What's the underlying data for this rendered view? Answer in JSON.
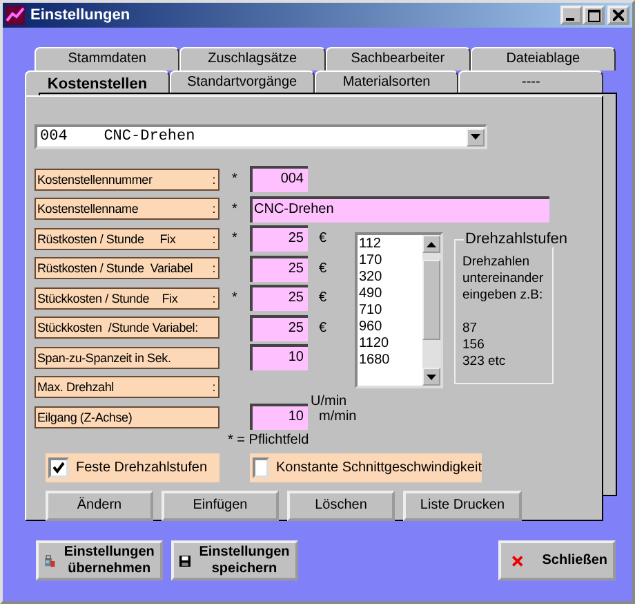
{
  "window": {
    "title": "Einstellungen"
  },
  "tab_rows": [
    {
      "tabs": [
        {
          "label": "Stammdaten",
          "selected": false
        },
        {
          "label": "Zuschlagsätze",
          "selected": false
        },
        {
          "label": "Sachbearbeiter",
          "selected": false
        },
        {
          "label": "Dateiablage",
          "selected": false
        }
      ]
    },
    {
      "tabs": [
        {
          "label": "Kostenstellen",
          "selected": true
        },
        {
          "label": "Standartvorgänge",
          "selected": false
        },
        {
          "label": "Materialsorten",
          "selected": false
        },
        {
          "label": "----",
          "selected": false
        }
      ]
    }
  ],
  "combo": {
    "value": "004    CNC-Drehen"
  },
  "fields": [
    {
      "label": "Kostenstellennummer",
      "colon": ":",
      "required": true,
      "kind": "short",
      "value": "004"
    },
    {
      "label": "Kostenstellenname",
      "colon": ":",
      "required": true,
      "kind": "wide",
      "value": "CNC-Drehen"
    },
    {
      "label": "Rüstkosten / Stunde     Fix",
      "colon": ":",
      "required": true,
      "kind": "short",
      "value": "25",
      "unit": "€"
    },
    {
      "label": "Rüstkosten / Stunde  Variabel",
      "colon": ":",
      "required": false,
      "kind": "short",
      "value": "25",
      "unit": "€"
    },
    {
      "label": "Stückkosten / Stunde    Fix",
      "colon": ":",
      "required": true,
      "kind": "short",
      "value": "25",
      "unit": "€"
    },
    {
      "label": "Stückkosten  /Stunde Variabel:",
      "required": false,
      "kind": "short",
      "value": "25",
      "unit": "€"
    },
    {
      "label": "Span-zu-Spanzeit in Sek.",
      "required": false,
      "kind": "short",
      "value": "10"
    },
    {
      "label": "Max. Drehzahl",
      "colon": ":",
      "required": false,
      "kind": "none",
      "unit": "U/min"
    },
    {
      "label": "Eilgang (Z-Achse)",
      "required": false,
      "kind": "short",
      "value": "10",
      "unit": "m/min"
    }
  ],
  "speed_list": [
    "112",
    "170",
    "320",
    "490",
    "710",
    "960",
    "1120",
    "1680"
  ],
  "speed_group": {
    "title": "Drehzahlstufen",
    "intro_lines": [
      "Drehzahlen",
      "untereinander",
      "eingeben z.B:"
    ],
    "example_lines": [
      "87",
      "156",
      "323 etc"
    ]
  },
  "required_note": "* = Pflichtfeld",
  "required_mark": "*",
  "checkboxes": [
    {
      "label": "Feste Drehzahlstufen",
      "checked": true
    },
    {
      "label": "Konstante Schnittgeschwindigkeit",
      "checked": false
    }
  ],
  "buttons": [
    "Ändern",
    "Einfügen",
    "Löschen",
    "Liste Drucken"
  ],
  "footer_buttons": [
    {
      "kind": "apply",
      "label": "Einstellungen übernehmen"
    },
    {
      "kind": "save",
      "label": "Einstellungen speichern"
    },
    {
      "kind": "close",
      "label": "Schließen"
    }
  ]
}
